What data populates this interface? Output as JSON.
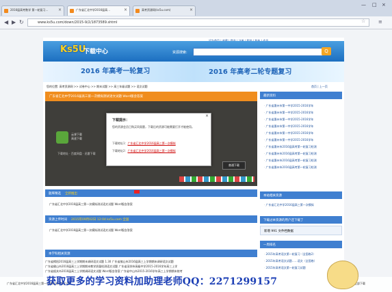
{
  "browser": {
    "tabs": [
      {
        "label": "2016届高考数学 第一轮复习...",
        "active": false,
        "color": "#f28a1e"
      },
      {
        "label": "广东省汇北中学2016届高...",
        "active": true,
        "color": "#f28a1e"
      },
      {
        "label": "高考资源网(ks5u.com)",
        "active": false,
        "color": "#f28a1e"
      }
    ],
    "url": "www.ks5u.com/down/2015-9/2/1873589.shtml",
    "window_controls": [
      "—",
      "□",
      "×"
    ]
  },
  "site": {
    "top_links": "设为首页 | 收藏 | 登录 | 注册 | 帮助 | 联系 | 会员",
    "logo": "Ks5U",
    "logo_sub": "下载中心",
    "search_label": "资源搜索:",
    "search_button": "Q",
    "banner_left": "2016 年高考一轮复习",
    "banner_right": "2016 年高考二轮专题复习",
    "breadcrumb": "您的位置: 高考资源网 >> 试卷中心 >> 期末试题 >> 高三年级试题 >> 语文试题",
    "breadcrumb_right": "首页 | 上一页"
  },
  "main": {
    "doc_title": "广东省汇北中学2016届高三第一次模拟测试语文试题 Word版含答案",
    "green_app_name": "云课下载",
    "green_app_sub": "高速下载",
    "download_line": "下载地址 · 百度网盘 · 迅雷下载",
    "download_button": "普通下载",
    "dialog": {
      "title": "下载提示：",
      "close": "×",
      "body": "您的资源会员已购买同类题，下载后的资源可能需要打开才能使用。",
      "addr1_label": "下载地址1：",
      "addr1_link": "广东省汇北中学2016届高三第一次模拟",
      "addr2_label": "下载地址2：",
      "addr2_link": "广东省汇北中学2016届高三第一次模拟"
    },
    "sections": [
      {
        "title": "题库精选",
        "accent": "全新推出",
        "text": "广东省汇北中学2016届高三第一次模拟测试语文试题 Word版含答案"
      },
      {
        "title": "资源上传时间",
        "accent": "2015年09月02日 12:04 ks5u.com 全国",
        "text": "广东省汇北中学2016届高三第一次模拟测试语文试题 Word版含答案"
      },
      {
        "title": "本学科相关资源",
        "accent": "",
        "text": "广东省揭阳市2016届高三上学期调研考试语文试题"
      }
    ],
    "related_lines": [
      "广东省揭阳2016届高三上学期期末调研语文试题 1.30    广东省佛山市2016届高三上学期期末调研语文试题",
      "广东省佛山市2016届高三上学期期末教学质量检测语文试题    广东省深圳市高级中学2015-2016学年高三上学",
      "广东省韶关市2016届高三上学期调研语文试题 Word版含答案    广东省中山市2015-2016学年高三上学期期末统考"
    ]
  },
  "sidebar": {
    "section1": "最新资料",
    "items1": [
      "广东省惠州市第一中学2015-2016学年",
      "广东省惠州市第一中学2015-2016学年",
      "广东省惠州市第一中学2015-2016学年",
      "广东省惠州市第一中学2015-2016学年",
      "广东省惠州市第一中学2015-2016学年",
      "广东省惠州市第一中学2015-2016学年",
      "广东省惠州市2016届高考第一轮复习检测",
      "广东省惠州市2016届高考第一轮复习检测",
      "广东省惠州市2016届高考第一轮复习检测",
      "广东省惠州市2016届高考第一轮复习检测"
    ],
    "section2": "本站相关资源",
    "items2": [
      "广东省汇北中学2016届高三第一次模拟"
    ],
    "section3": "下载过本资源的用户还下载了",
    "banner": "新增 991 文件档数据",
    "section4": "一周排名",
    "items4": [
      "2015年高考语文第一轮复习（全国卷2）",
      "2015年高考语文试题……语文（全国卷）",
      "2015年高考语文第一轮复习试题"
    ]
  },
  "statusbar": {
    "left": "广东省汇北中学2016届高三第一次模拟测试语文试题",
    "right": "显示全部下载"
  },
  "watermark": "获取更多的学习资料加助理老师QQ：2271299157",
  "colors": {
    "accent_orange": "#f08d1e",
    "header_blue": "#1c6fc0",
    "section_blue": "#3f7fd0",
    "watermark_blue": "#1c3fb5",
    "dark_panel": "#3f3e3a"
  }
}
